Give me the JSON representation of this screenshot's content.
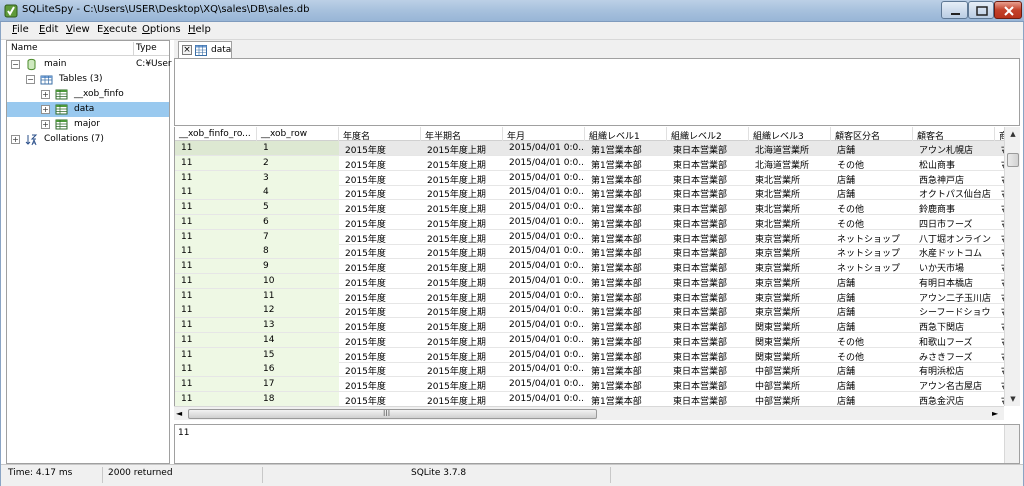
{
  "window": {
    "title": "SQLiteSpy - C:\\Users\\USER\\Desktop\\XQ\\sales\\DB\\sales.db"
  },
  "menu": [
    {
      "label": "File",
      "key": "F",
      "rest": "ile"
    },
    {
      "label": "Edit",
      "key": "E",
      "rest": "dit"
    },
    {
      "label": "View",
      "key": "V",
      "rest": "iew"
    },
    {
      "label": "Execute",
      "key": "x",
      "pre": "E",
      "rest": "ecute"
    },
    {
      "label": "Options",
      "key": "O",
      "rest": "ptions"
    },
    {
      "label": "Help",
      "key": "H",
      "rest": "elp"
    }
  ],
  "tree": {
    "header_name": "Name",
    "header_type": "Type",
    "items": [
      {
        "label": "main",
        "type": "C:¥User",
        "icon": "database-icon",
        "expander": "−"
      },
      {
        "label": "Tables (3)",
        "icon": "tables-icon",
        "expander": "−"
      },
      {
        "label": "__xob_finfo",
        "icon": "table-icon",
        "expander": "+"
      },
      {
        "label": "data",
        "icon": "table-icon",
        "expander": "+"
      },
      {
        "label": "major",
        "icon": "table-icon",
        "expander": "+"
      },
      {
        "label": "Collations (7)",
        "icon": "collations-icon",
        "expander": "+"
      }
    ]
  },
  "tab": {
    "label": "data"
  },
  "grid": {
    "columns": [
      "__xob_finfo_ro...",
      "__xob_row",
      "年度名",
      "年半期名",
      "年月",
      "組織レベル1",
      "組織レベル2",
      "組織レベル3",
      "顧客区分名",
      "顧客名",
      "商品"
    ],
    "rows": [
      [
        "11",
        "1",
        "2015年度",
        "2015年度上期",
        "2015/04/01 0:0...",
        "第1営業本部",
        "東日本営業部",
        "北海道営業所",
        "店舗",
        "アウン札幌店",
        "ﾏ"
      ],
      [
        "11",
        "2",
        "2015年度",
        "2015年度上期",
        "2015/04/01 0:0...",
        "第1営業本部",
        "東日本営業部",
        "北海道営業所",
        "その他",
        "松山商事",
        "ﾏ"
      ],
      [
        "11",
        "3",
        "2015年度",
        "2015年度上期",
        "2015/04/01 0:0...",
        "第1営業本部",
        "東日本営業部",
        "東北営業所",
        "店舗",
        "西急神戸店",
        "ﾏ"
      ],
      [
        "11",
        "4",
        "2015年度",
        "2015年度上期",
        "2015/04/01 0:0...",
        "第1営業本部",
        "東日本営業部",
        "東北営業所",
        "店舗",
        "オクトパス仙台店",
        "ﾏ"
      ],
      [
        "11",
        "5",
        "2015年度",
        "2015年度上期",
        "2015/04/01 0:0...",
        "第1営業本部",
        "東日本営業部",
        "東北営業所",
        "その他",
        "鈴鹿商事",
        "ﾏ"
      ],
      [
        "11",
        "6",
        "2015年度",
        "2015年度上期",
        "2015/04/01 0:0...",
        "第1営業本部",
        "東日本営業部",
        "東北営業所",
        "その他",
        "四日市フーズ",
        "ﾏ"
      ],
      [
        "11",
        "7",
        "2015年度",
        "2015年度上期",
        "2015/04/01 0:0...",
        "第1営業本部",
        "東日本営業部",
        "東京営業所",
        "ネットショップ",
        "八丁堀オンライン",
        "ﾏ"
      ],
      [
        "11",
        "8",
        "2015年度",
        "2015年度上期",
        "2015/04/01 0:0...",
        "第1営業本部",
        "東日本営業部",
        "東京営業所",
        "ネットショップ",
        "水産ドットコム",
        "ﾏ"
      ],
      [
        "11",
        "9",
        "2015年度",
        "2015年度上期",
        "2015/04/01 0:0...",
        "第1営業本部",
        "東日本営業部",
        "東京営業所",
        "ネットショップ",
        "いか天市場",
        "ﾏ"
      ],
      [
        "11",
        "10",
        "2015年度",
        "2015年度上期",
        "2015/04/01 0:0...",
        "第1営業本部",
        "東日本営業部",
        "東京営業所",
        "店舗",
        "有明日本橋店",
        "ﾏ"
      ],
      [
        "11",
        "11",
        "2015年度",
        "2015年度上期",
        "2015/04/01 0:0...",
        "第1営業本部",
        "東日本営業部",
        "東京営業所",
        "店舗",
        "アウン二子玉川店",
        "ﾏ"
      ],
      [
        "11",
        "12",
        "2015年度",
        "2015年度上期",
        "2015/04/01 0:0...",
        "第1営業本部",
        "東日本営業部",
        "東京営業所",
        "店舗",
        "シーフードショウ",
        "ﾏ"
      ],
      [
        "11",
        "13",
        "2015年度",
        "2015年度上期",
        "2015/04/01 0:0...",
        "第1営業本部",
        "東日本営業部",
        "関東営業所",
        "店舗",
        "西急下関店",
        "ﾏ"
      ],
      [
        "11",
        "14",
        "2015年度",
        "2015年度上期",
        "2015/04/01 0:0...",
        "第1営業本部",
        "東日本営業部",
        "関東営業所",
        "その他",
        "和歌山フーズ",
        "ﾏ"
      ],
      [
        "11",
        "15",
        "2015年度",
        "2015年度上期",
        "2015/04/01 0:0...",
        "第1営業本部",
        "東日本営業部",
        "関東営業所",
        "その他",
        "みさきフーズ",
        "ﾏ"
      ],
      [
        "11",
        "16",
        "2015年度",
        "2015年度上期",
        "2015/04/01 0:0...",
        "第1営業本部",
        "東日本営業部",
        "中部営業所",
        "店舗",
        "有明浜松店",
        "ﾏ"
      ],
      [
        "11",
        "17",
        "2015年度",
        "2015年度上期",
        "2015/04/01 0:0...",
        "第1営業本部",
        "東日本営業部",
        "中部営業所",
        "店舗",
        "アウン名古屋店",
        "ﾏ"
      ],
      [
        "11",
        "18",
        "2015年度",
        "2015年度上期",
        "2015/04/01 0:0...",
        "第1営業本部",
        "東日本営業部",
        "中部営業所",
        "店舗",
        "西急金沢店",
        "ﾏ"
      ]
    ]
  },
  "hscroll": {
    "grip": "III"
  },
  "detail": {
    "text": "11"
  },
  "status": {
    "time": "Time: 4.17 ms",
    "returned": "2000 returned",
    "version": "SQLite 3.7.8"
  }
}
